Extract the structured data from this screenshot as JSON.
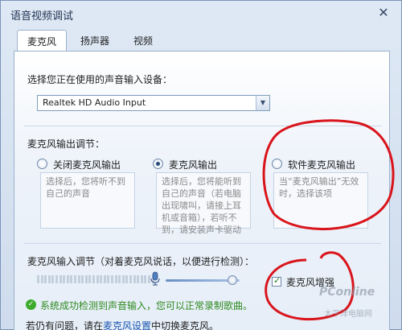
{
  "window": {
    "title": "语音视频调试",
    "close_glyph": "✕"
  },
  "tabs": [
    {
      "label": "麦克风",
      "active": true
    },
    {
      "label": "扬声器",
      "active": false
    },
    {
      "label": "视频",
      "active": false
    }
  ],
  "input_device": {
    "label": "选择您正在使用的声音输入设备：",
    "selected": "Realtek HD Audio Input"
  },
  "output": {
    "label": "麦克风输出调节：",
    "options": [
      {
        "label": "关闭麦克风输出",
        "checked": false,
        "desc": "选择后，您将听不到自己的声音"
      },
      {
        "label": "麦克风输出",
        "checked": true,
        "desc": "选择后，您将能听到自己的声音（若电脑出现啸叫，请接上耳机或音箱），若听不到，请安装声卡驱动"
      },
      {
        "label": "软件麦克风输出",
        "checked": false,
        "desc": "当“麦克风输出”无效时，选择该项"
      }
    ]
  },
  "input_adjust": {
    "label": "麦克风输入调节（对着麦克风说话，以便进行检测）：",
    "volume": 0.9,
    "boost_label": "麦克风增强",
    "boost_checked": true
  },
  "status": {
    "text": "系统成功检测到声音输入，您可以正常录制歌曲。",
    "color": "#2f8a1f"
  },
  "hint": {
    "prefix": "若仍有问题，请在",
    "link": "麦克风设置",
    "suffix": "中切换麦克风。"
  },
  "watermark": {
    "brand": "PConline",
    "sub": "太平洋电脑网"
  },
  "colors": {
    "annotation": "#d9141b",
    "accent": "#1a55b0"
  }
}
